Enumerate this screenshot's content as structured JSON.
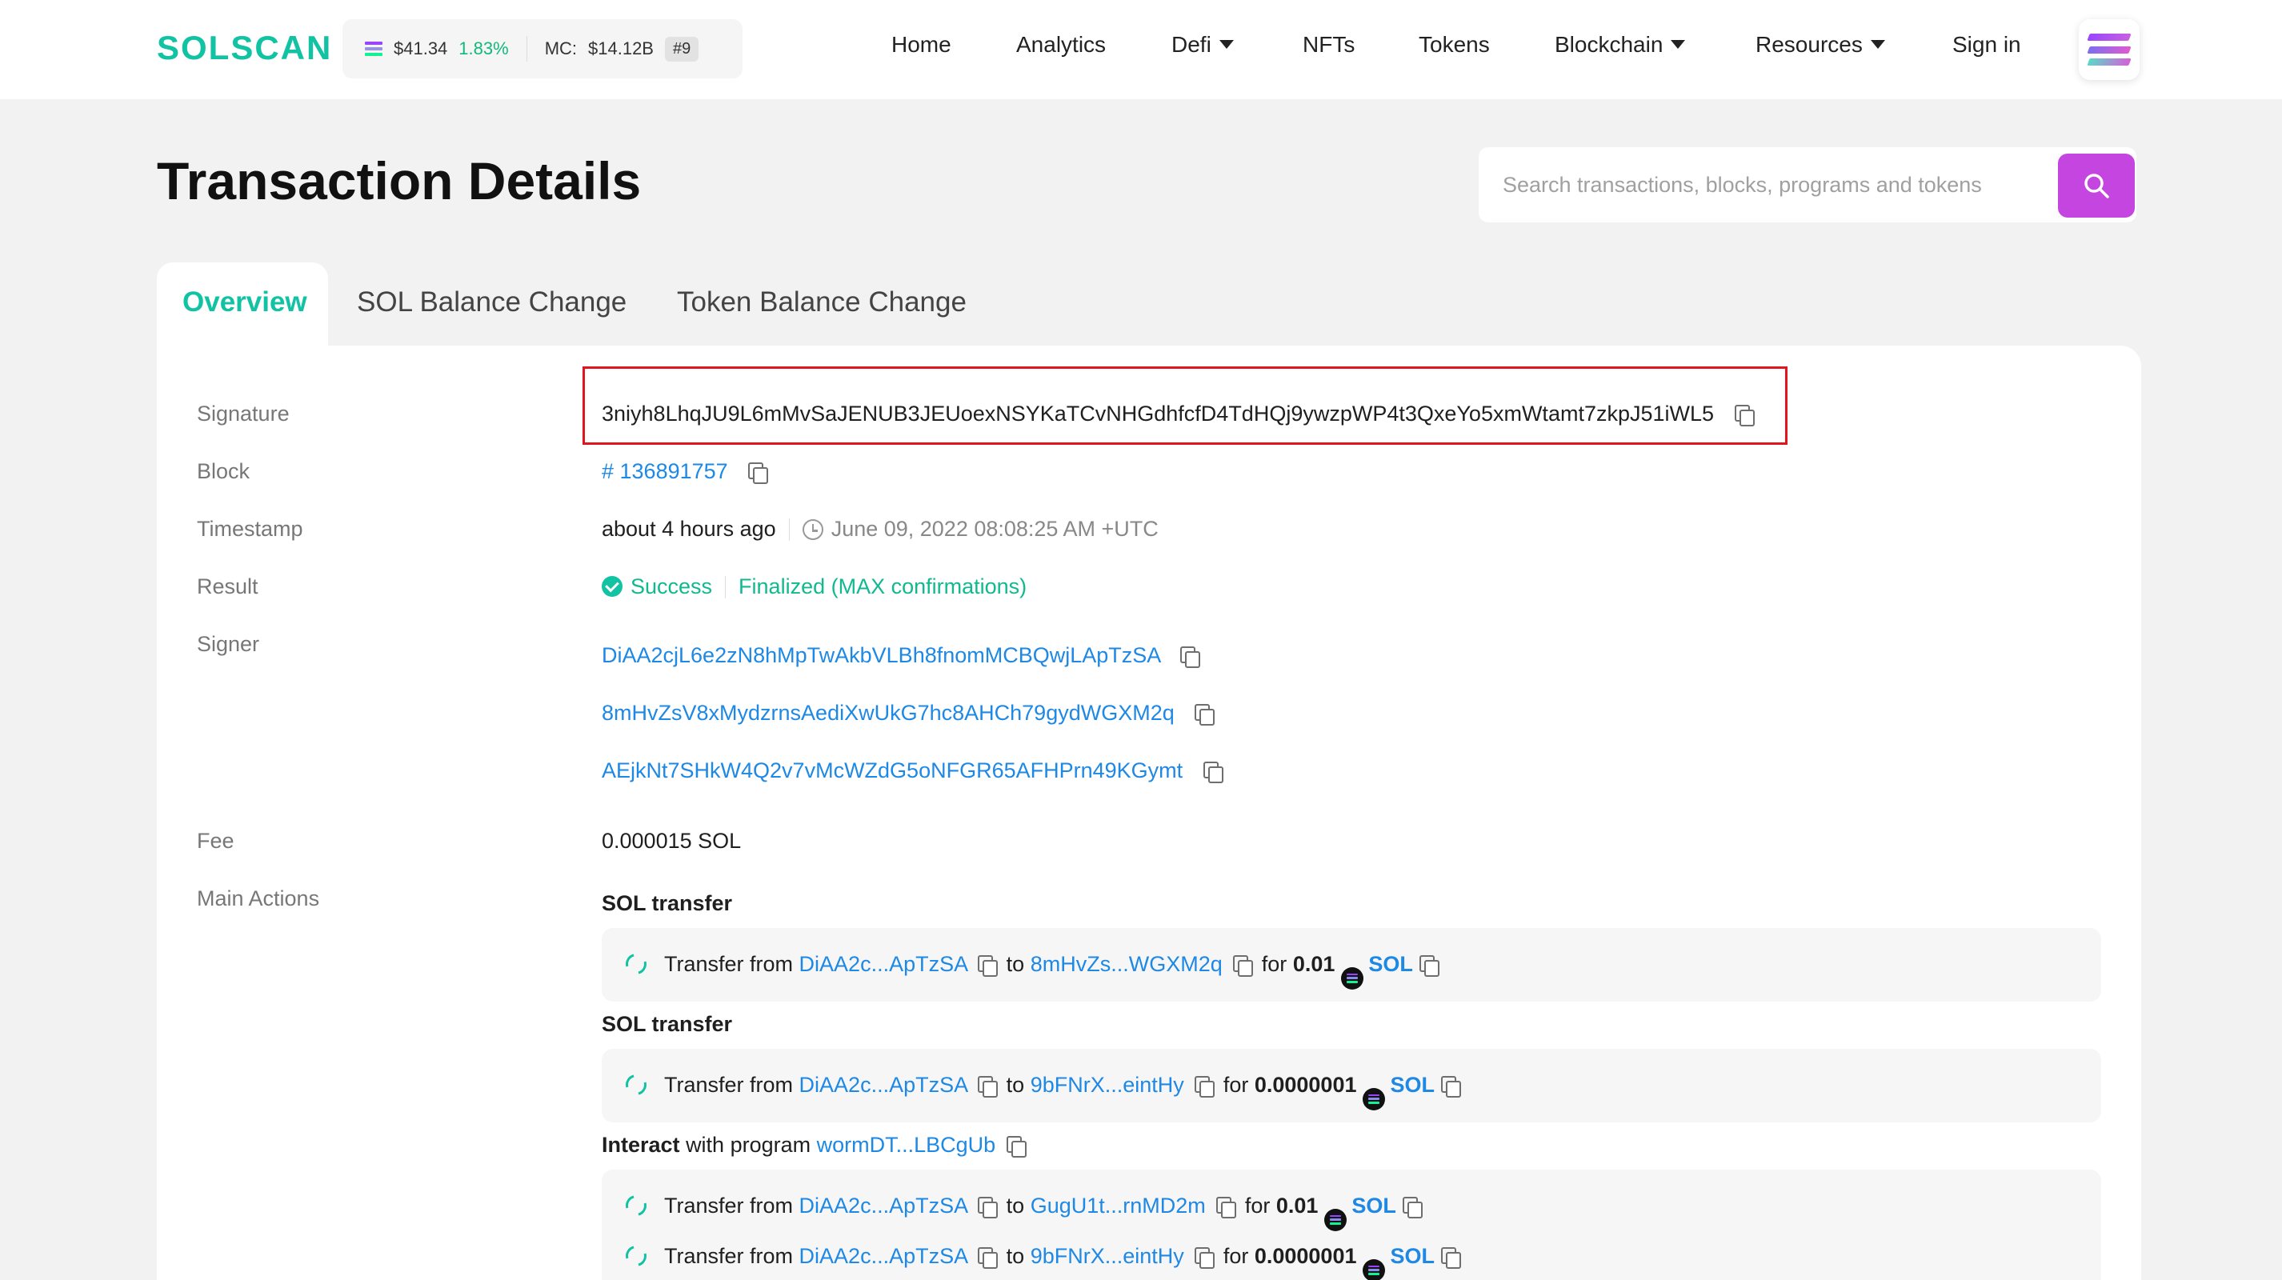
{
  "header": {
    "logo": "SOLSCAN",
    "price": "$41.34",
    "price_change": "1.83%",
    "mc_label": "MC:",
    "mc_value": "$14.12B",
    "rank": "#9",
    "nav": {
      "home": "Home",
      "analytics": "Analytics",
      "defi": "Defi",
      "nfts": "NFTs",
      "tokens": "Tokens",
      "blockchain": "Blockchain",
      "resources": "Resources",
      "signin": "Sign in"
    }
  },
  "page": {
    "title": "Transaction Details",
    "search_placeholder": "Search transactions, blocks, programs and tokens"
  },
  "tabs": {
    "overview": "Overview",
    "sol_balance": "SOL Balance Change",
    "token_balance": "Token Balance Change"
  },
  "details": {
    "signature_label": "Signature",
    "signature": "3niyh8LhqJU9L6mMvSaJENUB3JEUoexNSYKaTCvNHGdhfcfD4TdHQj9ywzpWP4t3QxeYo5xmWtamt7zkpJ51iWL5",
    "block_label": "Block",
    "block": "# 136891757",
    "timestamp_label": "Timestamp",
    "timestamp_relative": "about 4 hours ago",
    "timestamp_absolute": "June 09, 2022 08:08:25 AM +UTC",
    "result_label": "Result",
    "result_status": "Success",
    "result_confirmation": "Finalized (MAX confirmations)",
    "signer_label": "Signer",
    "signers": [
      "DiAA2cjL6e2zN8hMpTwAkbVLBh8fnomMCBQwjLApTzSA",
      "8mHvZsV8xMydzrnsAediXwUkG7hc8AHCh79gydWGXM2q",
      "AEjkNt7SHkW4Q2v7vMcWZdG5oNFGR65AFHPrn49KGymt"
    ],
    "fee_label": "Fee",
    "fee": "0.000015 SOL",
    "main_actions_label": "Main Actions"
  },
  "actions": {
    "sol_transfer_1_title": "SOL transfer",
    "sol_transfer_2_title": "SOL transfer",
    "interact_word": "Interact",
    "interact_text": "with program",
    "interact_program": "wormDT...LBCgUb",
    "transfer_from": "Transfer from",
    "to": "to",
    "for": "for",
    "token": "SOL",
    "rows": [
      {
        "from": "DiAA2c...ApTzSA",
        "to": "8mHvZs...WGXM2q",
        "amount": "0.01"
      },
      {
        "from": "DiAA2c...ApTzSA",
        "to": "9bFNrX...eintHy",
        "amount": "0.0000001"
      },
      {
        "from": "DiAA2c...ApTzSA",
        "to": "GugU1t...rnMD2m",
        "amount": "0.01"
      },
      {
        "from": "DiAA2c...ApTzSA",
        "to": "9bFNrX...eintHy",
        "amount": "0.0000001"
      }
    ]
  },
  "colors": {
    "brand": "#11c2a3",
    "search_button": "#c545e0",
    "link": "#1e88e5",
    "highlight_border": "#e0161f"
  }
}
